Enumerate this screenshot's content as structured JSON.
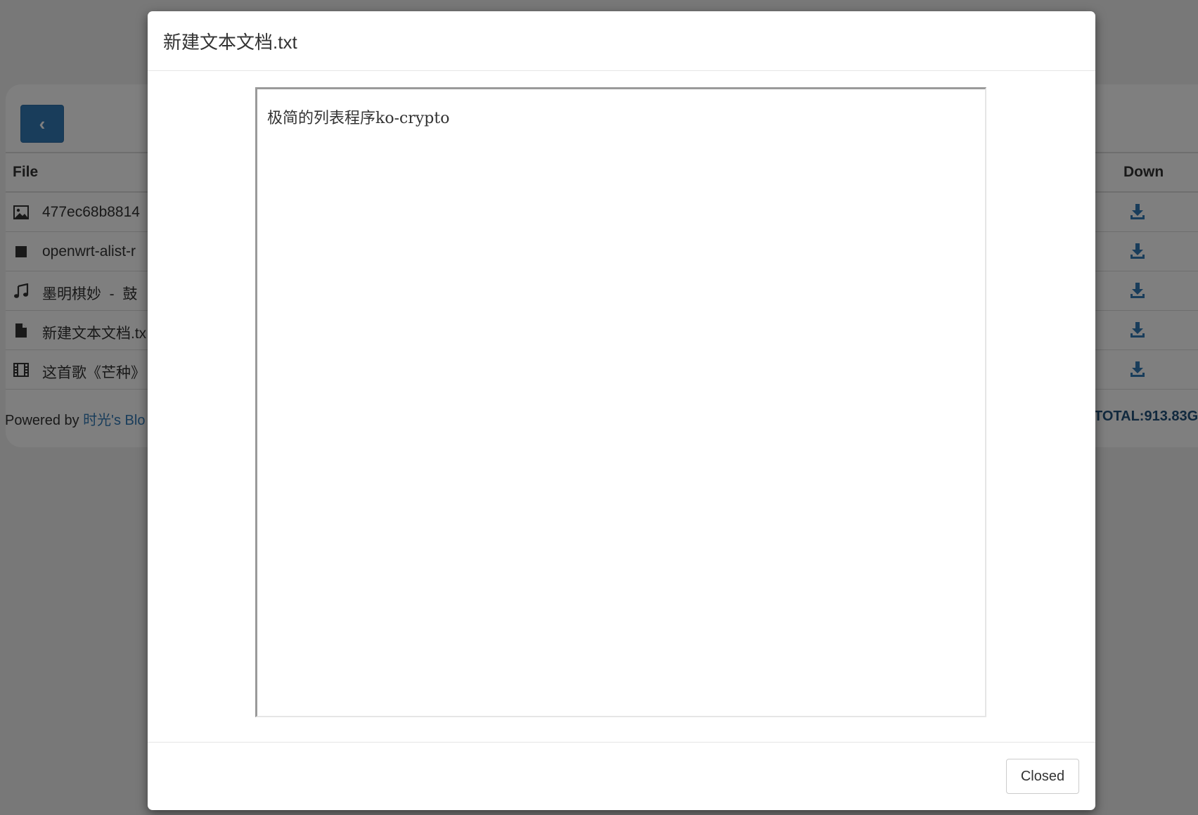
{
  "back_button": {
    "icon": "chevron-left-icon",
    "glyph": "‹"
  },
  "table": {
    "headers": {
      "file": "File",
      "down": "Down"
    },
    "rows": [
      {
        "icon": "image-icon",
        "name": "477ec68b8814"
      },
      {
        "icon": "stop-square-icon",
        "name": "openwrt-alist-r"
      },
      {
        "icon": "music-note-icon",
        "name": "墨明棋妙  -  鼓"
      },
      {
        "icon": "file-icon",
        "name": "新建文本文档.tx"
      },
      {
        "icon": "film-icon",
        "name": "这首歌《芒种》"
      }
    ],
    "download_icon": "download-icon"
  },
  "footer": {
    "powered_prefix": "Powered by ",
    "powered_link": "时光's Blo",
    "total": "TOTAL:913.83G"
  },
  "modal": {
    "title": "新建文本文档.txt",
    "content": "极简的列表程序ko-crypto",
    "close_label": "Closed"
  },
  "colors": {
    "primary": "#337ab7",
    "link": "#337ab7",
    "text": "#333333",
    "backdrop": "rgba(0,0,0,0.5)"
  }
}
